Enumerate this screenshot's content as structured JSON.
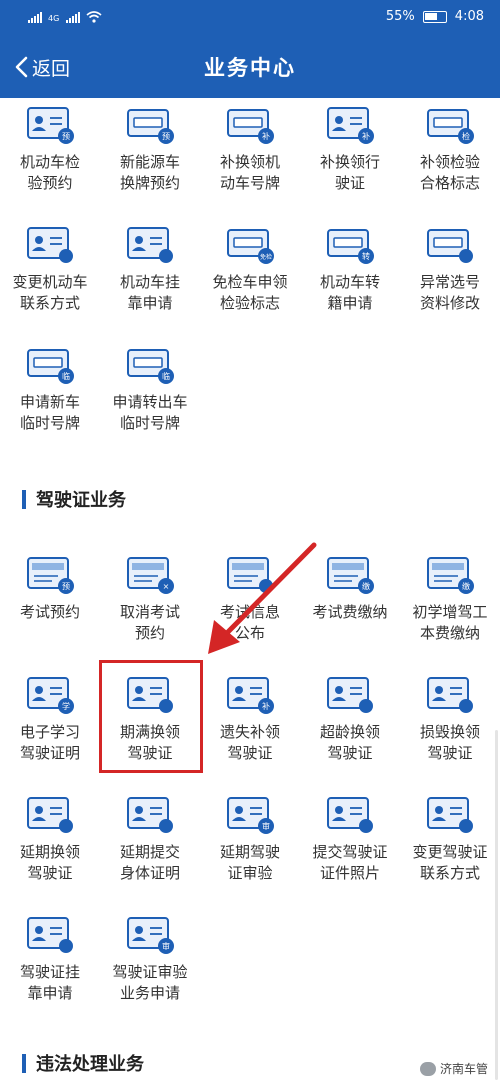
{
  "status_bar": {
    "network": "4G",
    "battery": "55%",
    "time": "4:08"
  },
  "nav": {
    "back_label": "返回",
    "title": "业务中心"
  },
  "vehicle_items": [
    {
      "label": "机动车检\n验预约",
      "icon": "inspection-card-icon",
      "badge": "预"
    },
    {
      "label": "新能源车\n换牌预约",
      "icon": "plate-swap-icon",
      "badge": "预"
    },
    {
      "label": "补换领机\n动车号牌",
      "icon": "plate-replace-icon",
      "badge": "补"
    },
    {
      "label": "补换领行\n驶证",
      "icon": "driving-license-replace-icon",
      "badge": "补"
    },
    {
      "label": "补领检验\n合格标志",
      "icon": "inspection-sticker-icon",
      "badge": "检"
    },
    {
      "label": "变更机动车\n联系方式",
      "icon": "contact-change-icon",
      "badge": ""
    },
    {
      "label": "机动车挂\n靠申请",
      "icon": "vehicle-affiliation-icon",
      "badge": ""
    },
    {
      "label": "免检车申领\n检验标志",
      "icon": "exempt-inspection-icon",
      "badge": "免检"
    },
    {
      "label": "机动车转\n籍申请",
      "icon": "vehicle-transfer-icon",
      "badge": "转"
    },
    {
      "label": "异常选号\n资料修改",
      "icon": "plate-selection-icon",
      "badge": ""
    },
    {
      "label": "申请新车\n临时号牌",
      "icon": "new-car-temp-plate-icon",
      "badge": "临"
    },
    {
      "label": "申请转出车\n临时号牌",
      "icon": "transfer-temp-plate-icon",
      "badge": "临"
    }
  ],
  "section_license": "驾驶证业务",
  "license_items": [
    {
      "label": "考试预约",
      "icon": "exam-booking-icon",
      "badge": "预"
    },
    {
      "label": "取消考试\n预约",
      "icon": "cancel-exam-icon",
      "badge": "×"
    },
    {
      "label": "考试信息\n公布",
      "icon": "exam-info-icon",
      "badge": ""
    },
    {
      "label": "考试费缴纳",
      "icon": "exam-fee-icon",
      "badge": "缴"
    },
    {
      "label": "初学增驾工\n本费缴纳",
      "icon": "learner-fee-icon",
      "badge": "缴"
    },
    {
      "label": "电子学习\n驾驶证明",
      "icon": "learning-certificate-icon",
      "badge": "学"
    },
    {
      "label": "期满换领\n驾驶证",
      "icon": "license-renewal-icon",
      "badge": ""
    },
    {
      "label": "遗失补领\n驾驶证",
      "icon": "lost-license-icon",
      "badge": "补"
    },
    {
      "label": "超龄换领\n驾驶证",
      "icon": "overage-license-icon",
      "badge": ""
    },
    {
      "label": "损毁换领\n驾驶证",
      "icon": "damaged-license-icon",
      "badge": ""
    },
    {
      "label": "延期换领\n驾驶证",
      "icon": "extension-renewal-icon",
      "badge": ""
    },
    {
      "label": "延期提交\n身体证明",
      "icon": "health-certificate-icon",
      "badge": ""
    },
    {
      "label": "延期驾驶\n证审验",
      "icon": "extension-review-icon",
      "badge": "审"
    },
    {
      "label": "提交驾驶证\n证件照片",
      "icon": "photo-upload-icon",
      "badge": ""
    },
    {
      "label": "变更驾驶证\n联系方式",
      "icon": "license-contact-change-icon",
      "badge": ""
    },
    {
      "label": "驾驶证挂\n靠申请",
      "icon": "license-affiliation-icon",
      "badge": ""
    },
    {
      "label": "驾驶证审验\n业务申请",
      "icon": "license-review-icon",
      "badge": "审"
    }
  ],
  "section_violation": "违法处理业务",
  "watermark": "济南车管",
  "colors": {
    "primary": "#1e5fb5",
    "highlight": "#d42626"
  }
}
